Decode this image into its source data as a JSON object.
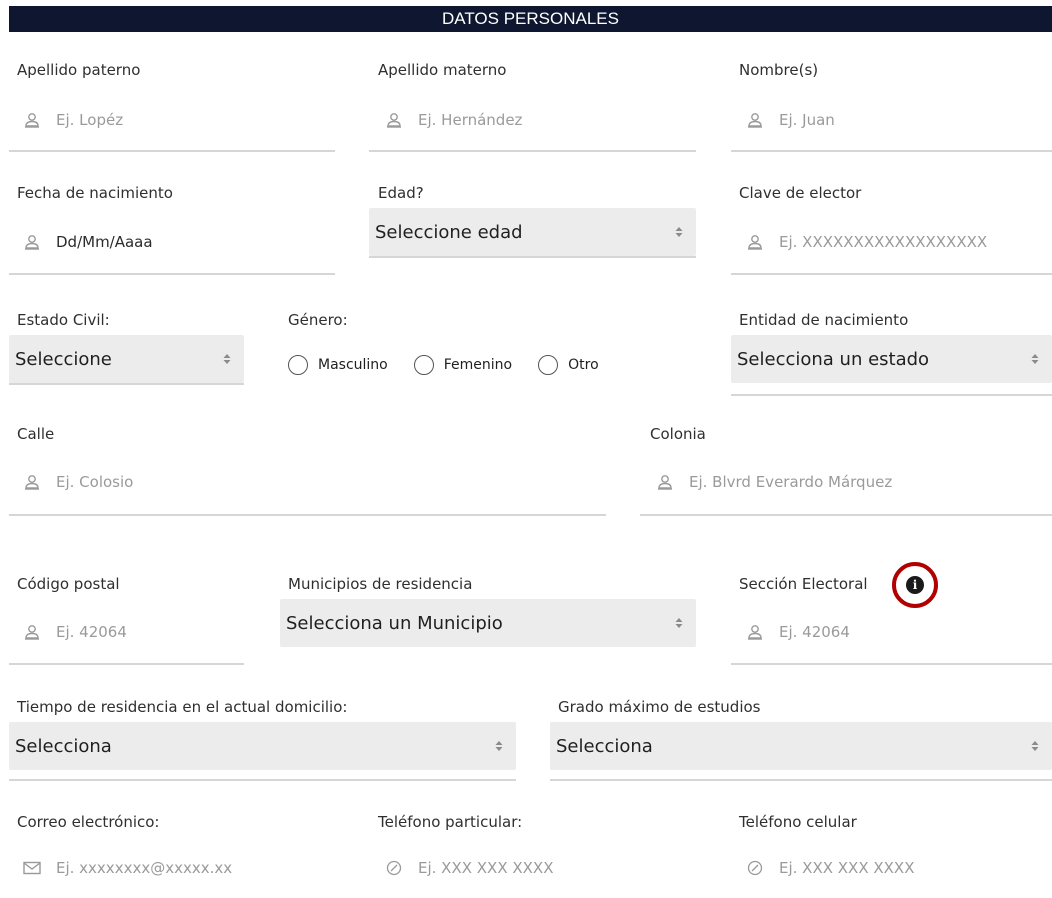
{
  "header": {
    "title": "DATOS PERSONALES"
  },
  "fields": {
    "apellido_paterno": {
      "label": "Apellido paterno",
      "placeholder": "Ej. Lopéz"
    },
    "apellido_materno": {
      "label": "Apellido materno",
      "placeholder": "Ej. Hernández"
    },
    "nombre": {
      "label": "Nombre(s)",
      "placeholder": "Ej. Juan"
    },
    "fecha_nacimiento": {
      "label": "Fecha de nacimiento",
      "value": "Dd/Mm/Aaaa"
    },
    "edad": {
      "label": "Edad?",
      "selected": "Seleccione edad"
    },
    "clave_elector": {
      "label": "Clave de elector",
      "placeholder": "Ej. XXXXXXXXXXXXXXXXXX"
    },
    "estado_civil": {
      "label": "Estado Civil:",
      "selected": "Seleccione"
    },
    "genero": {
      "label": "Género:",
      "options": [
        "Masculino",
        "Femenino",
        "Otro"
      ]
    },
    "entidad_nacimiento": {
      "label": "Entidad de nacimiento",
      "selected": "Selecciona un estado"
    },
    "calle": {
      "label": "Calle",
      "placeholder": "Ej. Colosio"
    },
    "colonia": {
      "label": "Colonia",
      "placeholder": "Ej. Blvrd Everardo Márquez"
    },
    "codigo_postal": {
      "label": "Código postal",
      "placeholder": "Ej. 42064"
    },
    "municipio": {
      "label": "Municipios de residencia",
      "selected": "Selecciona un Municipio"
    },
    "seccion_electoral": {
      "label": "Sección Electoral",
      "placeholder": "Ej. 42064",
      "info_glyph": "i"
    },
    "tiempo_residencia": {
      "label": "Tiempo de residencia en el actual domicilio:",
      "selected": "Selecciona"
    },
    "grado_estudios": {
      "label": "Grado máximo de estudios",
      "selected": "Selecciona"
    },
    "correo": {
      "label": "Correo electrónico:",
      "placeholder": "Ej. xxxxxxxx@xxxxx.xx"
    },
    "telefono_particular": {
      "label": "Teléfono particular:",
      "placeholder": "Ej. XXX XXX XXXX"
    },
    "telefono_celular": {
      "label": "Teléfono celular",
      "placeholder": "Ej. XXX XXX XXXX"
    }
  },
  "icons": {
    "person": "person-icon",
    "mail": "mail-icon",
    "phone": "phone-icon",
    "info": "info-icon",
    "select": "select-arrows-icon"
  },
  "colors": {
    "header_bg": "#0f1630",
    "select_bg": "#ececec",
    "highlight_ring": "#b00000",
    "underline": "#d6d6d6",
    "placeholder": "#9a9a9a"
  }
}
